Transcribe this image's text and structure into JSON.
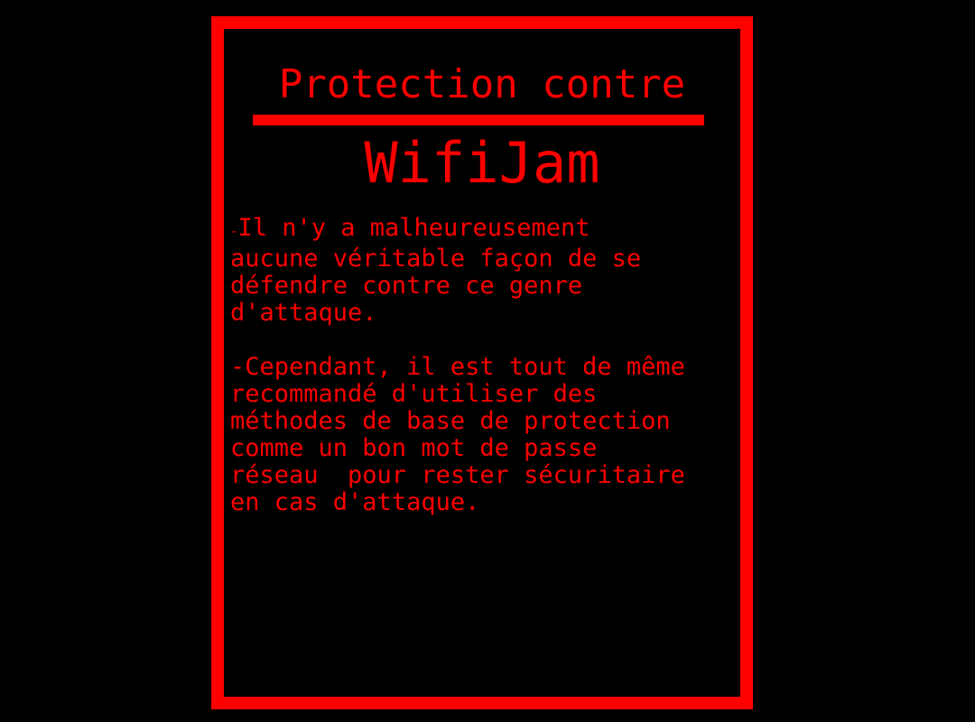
{
  "slide": {
    "title": "Protection contre",
    "subtitle": "WifiJam",
    "paragraph1": {
      "dash": "-",
      "text": "Il n'y a malheureusement\naucune véritable façon de se\ndéfendre contre ce genre\nd'attaque."
    },
    "paragraph2": {
      "text": "-Cependant, il est tout de même\nrecommandé d'utiliser des\nméthodes de base de protection\ncomme un bon mot de passe\nréseau  pour rester sécuritaire\nen cas d'attaque."
    }
  },
  "colors": {
    "background": "#000000",
    "accent": "#ff0000"
  }
}
